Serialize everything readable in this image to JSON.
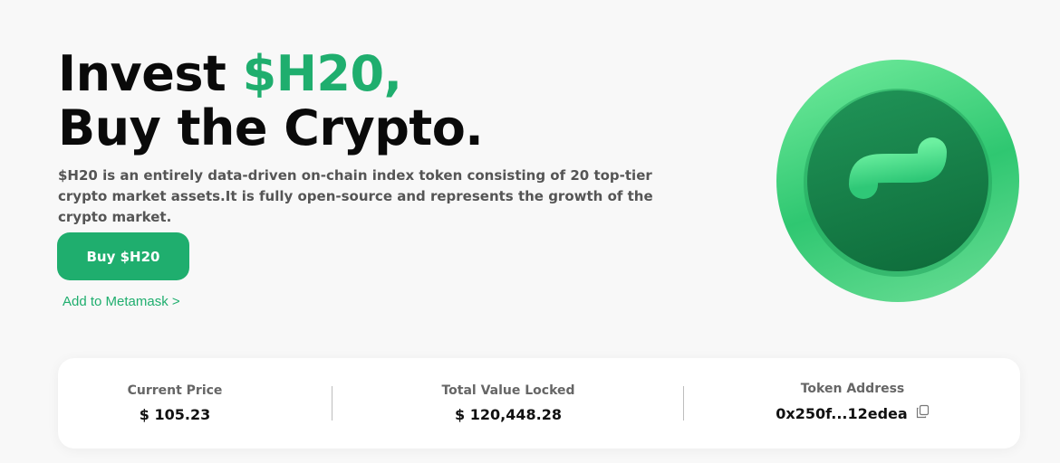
{
  "hero": {
    "title_line1_prefix": "Invest ",
    "title_line1_accent": "$H20,",
    "title_line2": "Buy the Crypto.",
    "description": "$H20 is an entirely data-driven on-chain index token consisting of 20 top-tier crypto market assets.It is fully open-source and represents the growth of the crypto market.",
    "buy_button_label": "Buy $H20",
    "metamask_link_label": "Add to Metamask >"
  },
  "stats": {
    "current_price_label": "Current Price",
    "current_price_value": "$ 105.23",
    "tvl_label": "Total Value Locked",
    "tvl_value": "$ 120,448.28",
    "token_address_label": "Token Address",
    "token_address_value": "0x250f...12edea"
  },
  "colors": {
    "accent": "#1fae6e",
    "text_dark": "#0a0a0a",
    "text_muted": "#555555"
  },
  "icons": {
    "logo": "h20-coin-logo",
    "copy": "copy-icon"
  }
}
